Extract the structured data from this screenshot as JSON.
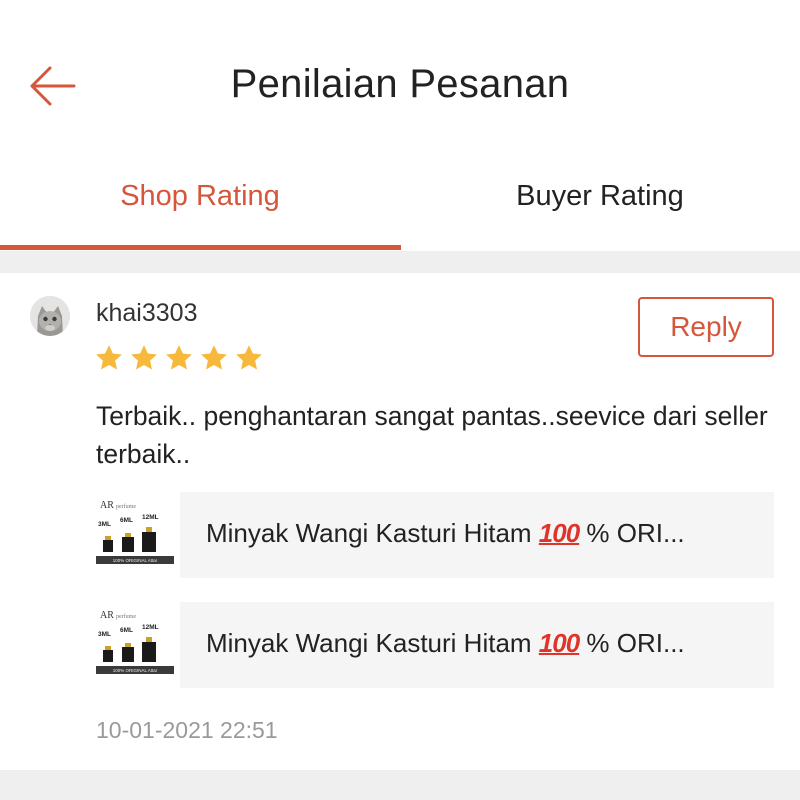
{
  "header": {
    "title": "Penilaian Pesanan",
    "back_icon": "arrow-left-icon"
  },
  "tabs": [
    {
      "label": "Shop Rating",
      "active": true
    },
    {
      "label": "Buyer Rating",
      "active": false
    }
  ],
  "colors": {
    "accent": "#d5563a",
    "star": "#f6b93b",
    "separator": "#efefef",
    "muted_text": "#9a9a9a"
  },
  "review": {
    "username": "khai3303",
    "rating": 5,
    "max_rating": 5,
    "reply_label": "Reply",
    "text": "Terbaik.. penghantaran sangat pantas..seevice dari seller terbaik..",
    "timestamp": "10-01-2021 22:51",
    "products": [
      {
        "name_prefix": "Minyak Wangi Kasturi Hitam ",
        "name_emoji": "100",
        "name_suffix": " % ORI...",
        "thumb": {
          "brand": "AR",
          "brand_sub": "perfume",
          "sizes": [
            "3ML",
            "6ML",
            "12ML"
          ],
          "tagline": "100% ORIGINAL Attar"
        }
      },
      {
        "name_prefix": "Minyak Wangi Kasturi Hitam ",
        "name_emoji": "100",
        "name_suffix": " % ORI...",
        "thumb": {
          "brand": "AR",
          "brand_sub": "perfume",
          "sizes": [
            "3ML",
            "6ML",
            "12ML"
          ],
          "tagline": "100% ORIGINAL Attar"
        }
      }
    ]
  }
}
